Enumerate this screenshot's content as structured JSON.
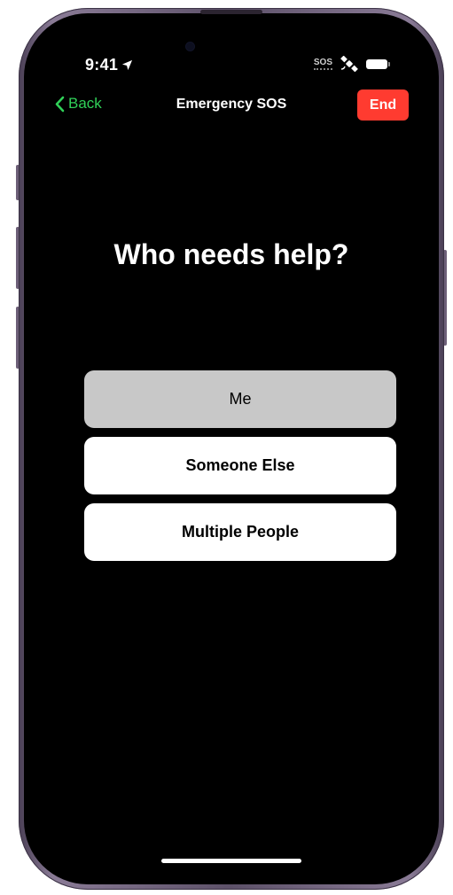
{
  "status_bar": {
    "time": "9:41",
    "sos_label": "SOS"
  },
  "nav": {
    "back_label": "Back",
    "title": "Emergency SOS",
    "end_label": "End"
  },
  "prompt": {
    "question": "Who needs help?"
  },
  "options": [
    {
      "label": "Me",
      "selected": true
    },
    {
      "label": "Someone Else",
      "selected": false
    },
    {
      "label": "Multiple People",
      "selected": false
    }
  ],
  "colors": {
    "accent_green": "#30d158",
    "end_red": "#ff3b30",
    "selected_gray": "#c8c8c8",
    "frame_purple": "#6d5f78"
  },
  "icons": [
    "location-arrow-icon",
    "satellite-icon",
    "battery-icon",
    "chevron-left-icon"
  ]
}
